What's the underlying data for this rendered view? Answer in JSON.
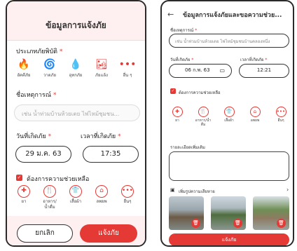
{
  "left": {
    "title": "ข้อมูลการแจ้งภัย",
    "category_label": "ประเภทภัยพิบัติ",
    "categories": [
      {
        "icon": "fire-icon",
        "glyph": "🔥",
        "label": "อัคคีภัย"
      },
      {
        "icon": "storm-icon",
        "glyph": "🌀",
        "label": "วาตภัย"
      },
      {
        "icon": "flood-icon",
        "glyph": "💧",
        "label": "อุทกภัย"
      },
      {
        "icon": "drought-icon",
        "glyph": "🏜",
        "label": "ภัยแล้ง"
      },
      {
        "icon": "more-icon",
        "glyph": "•••",
        "label": "อื่น ๆ"
      }
    ],
    "name_label": "ชื่อเหตุการณ์",
    "name_placeholder": "เช่น น้ำท่วมบ้านห้วยเตย ไฟไหม้ชุมชน...",
    "date_label": "วันที่เกิดภัย",
    "time_label": "เวลาที่เกิดภัย",
    "date_value": "29 ม.ค. 63",
    "time_value": "17:35",
    "help_label": "ต้องการความช่วยเหลือ",
    "help_items": [
      {
        "icon": "medicine-icon",
        "glyph": "✚",
        "label": "ยา"
      },
      {
        "icon": "food-icon",
        "glyph": "🍴",
        "label": "อาหาร/\nน้ำดื่ม"
      },
      {
        "icon": "clothes-icon",
        "glyph": "👕",
        "label": "เสื้อผ้า"
      },
      {
        "icon": "shelter-icon",
        "glyph": "⌂",
        "label": "ลพยพ"
      },
      {
        "icon": "more-icon",
        "glyph": "•••",
        "label": "อื่นๆ"
      }
    ],
    "cancel_label": "ยกเลิก",
    "report_label": "แจ้งภัย"
  },
  "right": {
    "back_glyph": "←",
    "title": "ข้อมูลการแจ้งภัยและขอความช่วย...",
    "name_label": "ชื่อเหตุการณ์",
    "name_placeholder": "เช่น น้ำท่วมบ้านห้วยเตย ไฟไหม้ชุมชนบ้านคลองหนึ่ง",
    "date_label": "วันที่เกิดภัย",
    "time_label": "เวลาที่เกิดภัย",
    "date_value": "06 ก.พ. 63",
    "time_value": "12:21",
    "help_label": "ต้องการความช่วยเหลือ",
    "help_items": [
      {
        "icon": "medicine-icon",
        "glyph": "✚",
        "label": "ยา"
      },
      {
        "icon": "food-icon",
        "glyph": "🍴",
        "label": "อาหาร/น้ำ\nดื่ม"
      },
      {
        "icon": "clothes-icon",
        "glyph": "👕",
        "label": "เสื้อผ้า"
      },
      {
        "icon": "shelter-icon",
        "glyph": "⌂",
        "label": "อพยพ"
      },
      {
        "icon": "more-icon",
        "glyph": "•••",
        "label": "อื่นๆ"
      }
    ],
    "detail_label": "รายละเอียดเพิ่มเติม",
    "photo_label": "เพิ่มรูปความเสียหาย",
    "submit_label": "แจ้งภัย"
  },
  "colors": {
    "accent": "#e53935",
    "header_bg": "#fef0f0"
  }
}
